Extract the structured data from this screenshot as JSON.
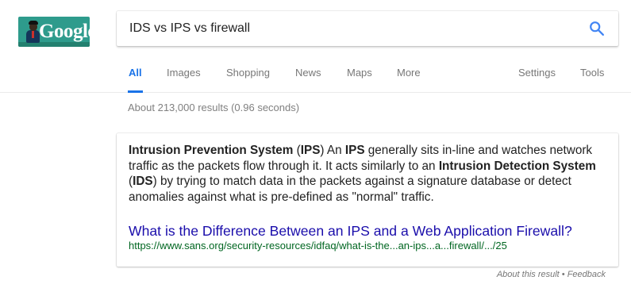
{
  "logo": {
    "text": "Google",
    "icon": "google-doodle-logo"
  },
  "search": {
    "query": "IDS vs IPS vs firewall",
    "button_icon": "search-icon"
  },
  "tabs": {
    "all": "All",
    "images": "Images",
    "shopping": "Shopping",
    "news": "News",
    "maps": "Maps",
    "more": "More",
    "settings": "Settings",
    "tools": "Tools"
  },
  "stats": "About 213,000 results (0.96 seconds)",
  "featured": {
    "snippet": [
      {
        "t": "Intrusion Prevention System",
        "b": true
      },
      {
        "t": " (",
        "b": false
      },
      {
        "t": "IPS",
        "b": true
      },
      {
        "t": ") An ",
        "b": false
      },
      {
        "t": "IPS",
        "b": true
      },
      {
        "t": " generally sits in-line and watches network traffic as the packets flow through it. It acts similarly to an ",
        "b": false
      },
      {
        "t": "Intrusion Detection System",
        "b": true
      },
      {
        "t": " (",
        "b": false
      },
      {
        "t": "IDS",
        "b": true
      },
      {
        "t": ") by trying to match data in the packets against a signature database or detect anomalies against what is pre-defined as \"normal\" traffic.",
        "b": false
      }
    ],
    "title": "What is the Difference Between an IPS and a Web Application Firewall?",
    "url": "https://www.sans.org/security-resources/idfaq/what-is-the...an-ips...a...firewall/.../25"
  },
  "footer": {
    "about": "About this result",
    "separator": " • ",
    "feedback": "Feedback"
  },
  "colors": {
    "link": "#1a0dab",
    "url": "#006621",
    "accent": "#1a73e8",
    "logo_bg": "#2e9b8c"
  }
}
